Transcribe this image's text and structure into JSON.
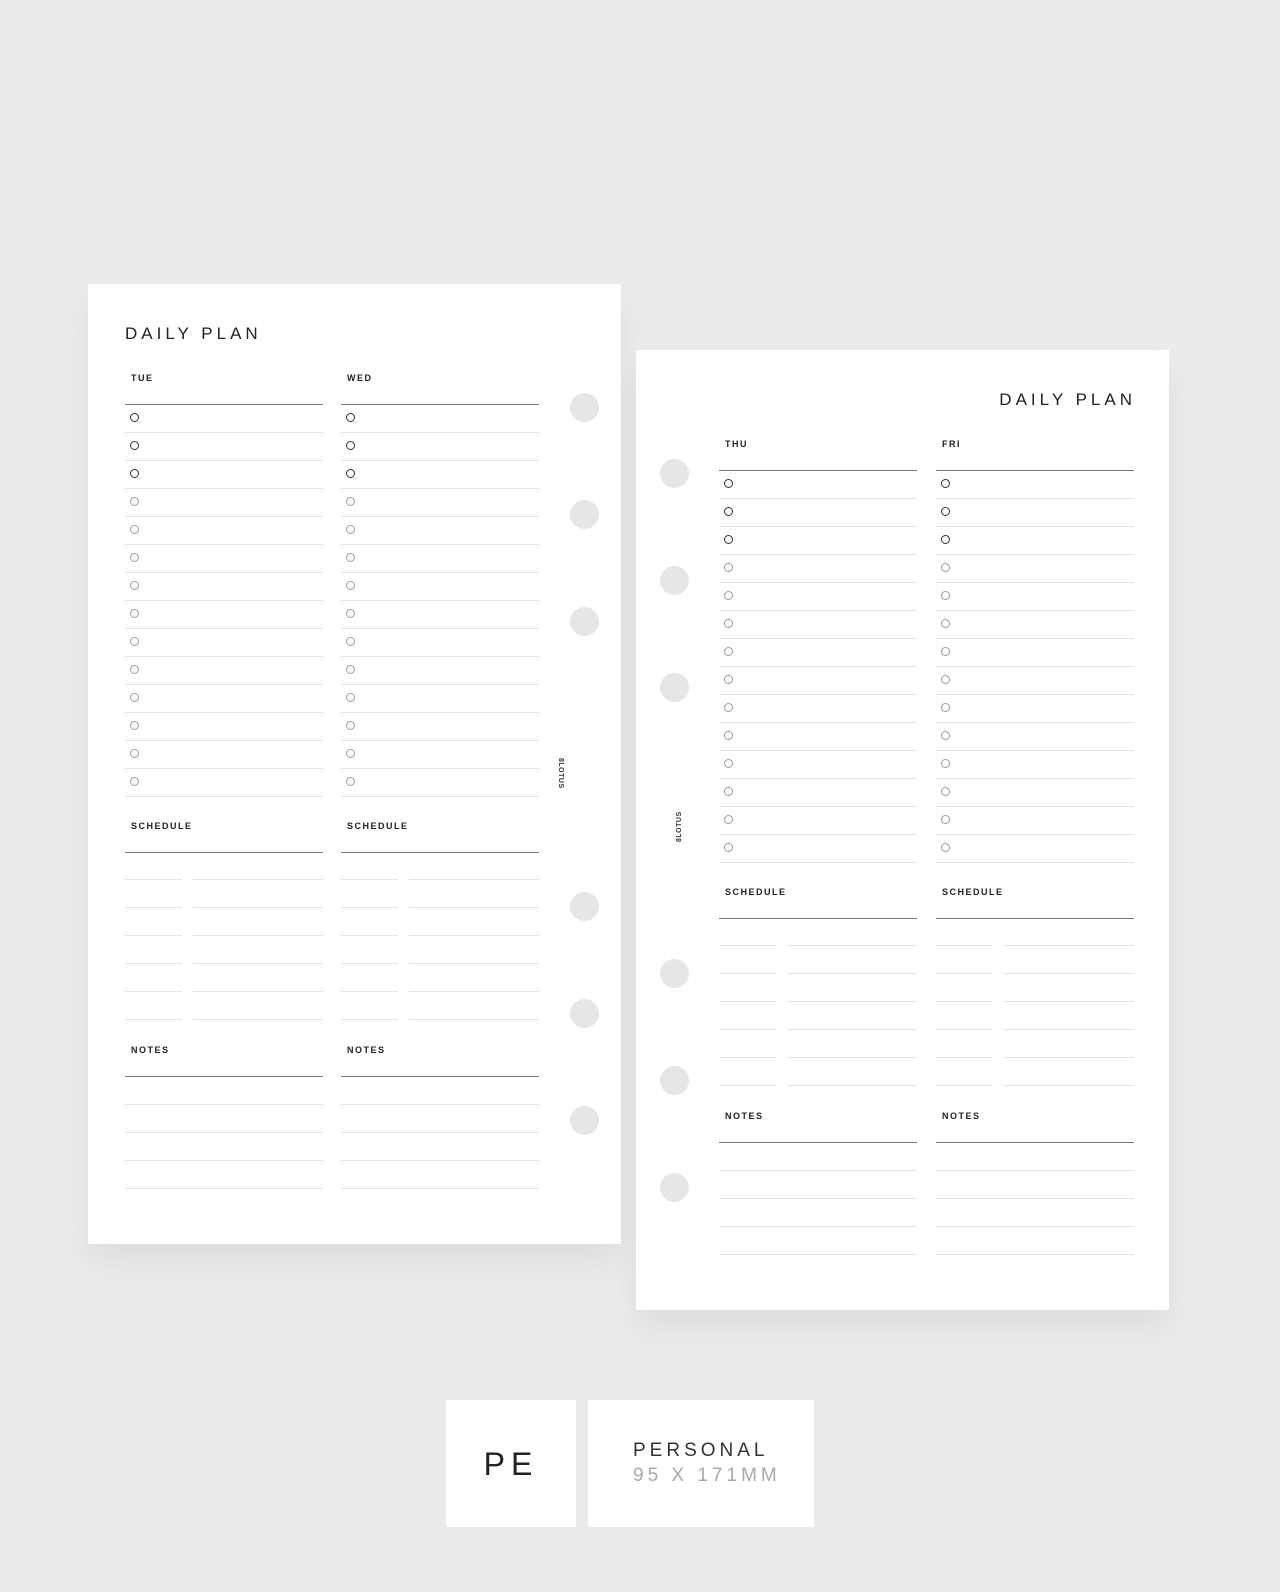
{
  "pages": [
    {
      "title": "DAILY PLAN",
      "brand": "8LOTUS",
      "days": [
        {
          "day": "TUE",
          "schedule_label": "SCHEDULE",
          "notes_label": "NOTES"
        },
        {
          "day": "WED",
          "schedule_label": "SCHEDULE",
          "notes_label": "NOTES"
        }
      ]
    },
    {
      "title": "DAILY PLAN",
      "brand": "8LOTUS",
      "days": [
        {
          "day": "THU",
          "schedule_label": "SCHEDULE",
          "notes_label": "NOTES"
        },
        {
          "day": "FRI",
          "schedule_label": "SCHEDULE",
          "notes_label": "NOTES"
        }
      ]
    }
  ],
  "layout_counts": {
    "task_rows_per_day": 14,
    "priority_task_rows": 3,
    "schedule_rows": 6,
    "notes_rows": 4,
    "binder_holes_per_page": 6
  },
  "size": {
    "code": "PE",
    "name": "PERSONAL",
    "dimensions": "95 X 171MM"
  }
}
